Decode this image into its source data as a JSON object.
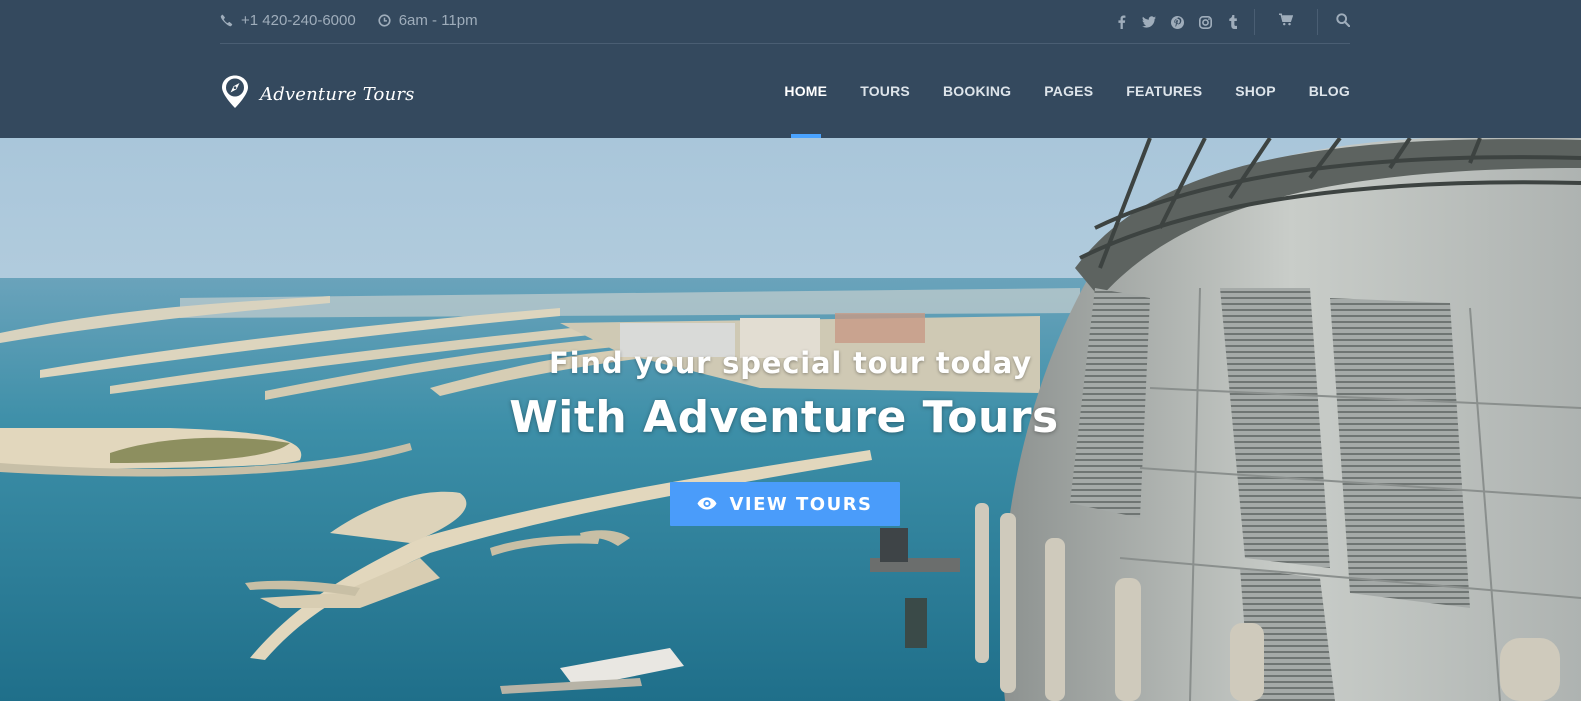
{
  "topbar": {
    "phone": "+1 420-240-6000",
    "hours": "6am - 11pm",
    "social": [
      {
        "name": "facebook-icon",
        "glyph": "f"
      },
      {
        "name": "twitter-icon",
        "glyph": "t"
      },
      {
        "name": "pinterest-icon",
        "glyph": "p"
      },
      {
        "name": "instagram-icon",
        "glyph": "i"
      },
      {
        "name": "tumblr-icon",
        "glyph": "t"
      }
    ]
  },
  "brand": {
    "name": "Adventure Tours"
  },
  "nav": {
    "items": [
      {
        "label": "HOME",
        "active": true
      },
      {
        "label": "TOURS"
      },
      {
        "label": "BOOKING"
      },
      {
        "label": "PAGES"
      },
      {
        "label": "FEATURES"
      },
      {
        "label": "SHOP"
      },
      {
        "label": "BLOG"
      }
    ]
  },
  "hero": {
    "subtitle": "Find your special tour today",
    "title": "With Adventure Tours",
    "button_label": "VIEW TOURS"
  },
  "colors": {
    "header_bg": "#34495e",
    "accent": "#4a9cfa",
    "muted_text": "#9fadbb"
  }
}
